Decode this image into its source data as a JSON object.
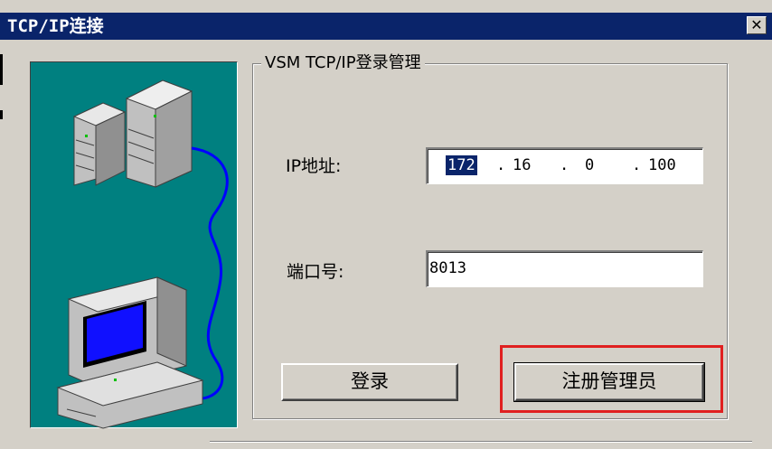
{
  "window": {
    "title": "TCP/IP连接",
    "close_glyph": "✕"
  },
  "group": {
    "legend": "VSM TCP/IP登录管理"
  },
  "ip": {
    "label": "IP地址:",
    "octets": [
      "172",
      "16",
      "0",
      "100"
    ],
    "selected_octet": 0
  },
  "port": {
    "label": "端口号:",
    "value": "8013"
  },
  "buttons": {
    "login": "登录",
    "register_admin": "注册管理员"
  },
  "colors": {
    "titlebar": "#0a246a",
    "dialog": "#d4d0c8",
    "illustration_bg": "#008080",
    "highlight": "#e02020"
  },
  "icons": [
    "server-icon",
    "computer-icon",
    "network-cable-icon"
  ]
}
